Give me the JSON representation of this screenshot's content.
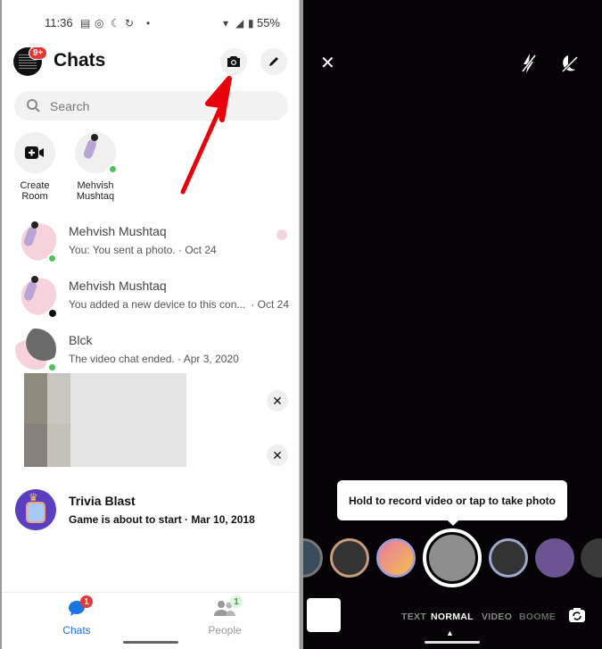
{
  "left": {
    "status_bar": {
      "time": "11:36",
      "battery": "55%"
    },
    "header": {
      "title": "Chats",
      "avatar_badge": "9+",
      "camera_icon": "camera-icon",
      "compose_icon": "pencil-icon"
    },
    "search": {
      "placeholder": "Search"
    },
    "stories": [
      {
        "label_line1": "Create",
        "label_line2": "Room",
        "icon": "video-plus-icon"
      },
      {
        "label_line1": "Mehvish",
        "label_line2": "Mushtaq",
        "online": true
      }
    ],
    "chats": [
      {
        "name": "Mehvish Mushtaq",
        "preview": "You: You sent a photo. · Oct 24",
        "date": "",
        "online": true,
        "seen_avatar": true
      },
      {
        "name": "Mehvish Mushtaq",
        "preview": "You added a new device to this con...",
        "date": "· Oct 24",
        "lock": true
      },
      {
        "name": "Blck",
        "preview": "The video chat ended. · Apr 3, 2020",
        "date": "",
        "online": true
      },
      {
        "name": "",
        "preview": "",
        "blurred": true,
        "dismiss": "✕"
      },
      {
        "name": "",
        "preview": "",
        "blurred": true,
        "dismiss": "✕"
      },
      {
        "name": "Trivia Blast",
        "preview": "Game is about to start · Mar 10, 2018",
        "unread": true
      }
    ],
    "bottom_nav": [
      {
        "label": "Chats",
        "badge": "1",
        "active": true,
        "color": "#1b74e4"
      },
      {
        "label": "People",
        "badge": "1",
        "active": false,
        "color": "#9a9a9a"
      }
    ],
    "annotation_color": "#e8000b"
  },
  "right": {
    "top_controls": {
      "close": "✕",
      "flash_off": "flash-off-icon",
      "night_mode_off": "night-mode-off-icon"
    },
    "tooltip": "Hold to record video or tap to take photo",
    "modes": [
      "TEXT",
      "NORMAL",
      "VIDEO",
      "BOOME"
    ],
    "active_mode": "NORMAL"
  }
}
